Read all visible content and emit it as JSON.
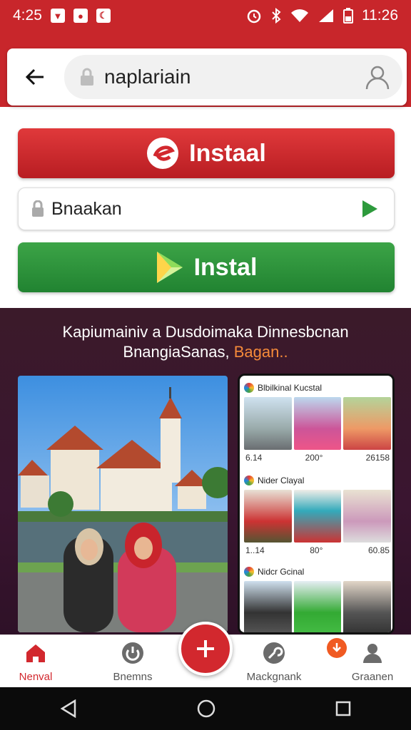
{
  "status": {
    "time_left": "4:25",
    "time_right": "11:26"
  },
  "url_bar": {
    "text": "naplariain"
  },
  "install_red": {
    "label": "Instaal"
  },
  "field": {
    "text": "Bnaakan"
  },
  "install_green": {
    "label": "Instal"
  },
  "promo": {
    "line1": "Kapiumainiv a Dusdoimaka Dinnesbcnan",
    "line2": "BnangiaSanas,",
    "line2_highlight": "Bagan..",
    "highlight_color": "#f58a3a"
  },
  "feed": {
    "sections": [
      {
        "title": "Blbilkinal Kucstal",
        "nums": [
          "6.14",
          "200°",
          "26158"
        ]
      },
      {
        "title": "Nider Clayal",
        "nums": [
          "1..14",
          "80°",
          "60.85"
        ]
      },
      {
        "title": "Nidcr Gcinal",
        "nums": []
      }
    ]
  },
  "bottom_nav": {
    "items": [
      {
        "label": "Nenval",
        "icon": "home-icon"
      },
      {
        "label": "Bnemns",
        "icon": "power-icon"
      },
      {
        "label": "Mackgnank",
        "icon": "wrench-icon"
      },
      {
        "label": "Graanen",
        "icon": "person-icon"
      }
    ],
    "fab_icon": "plus-icon"
  },
  "colors": {
    "brand_red": "#c8262b",
    "green": "#2d9a3c",
    "active_tab": "#d2282e"
  }
}
